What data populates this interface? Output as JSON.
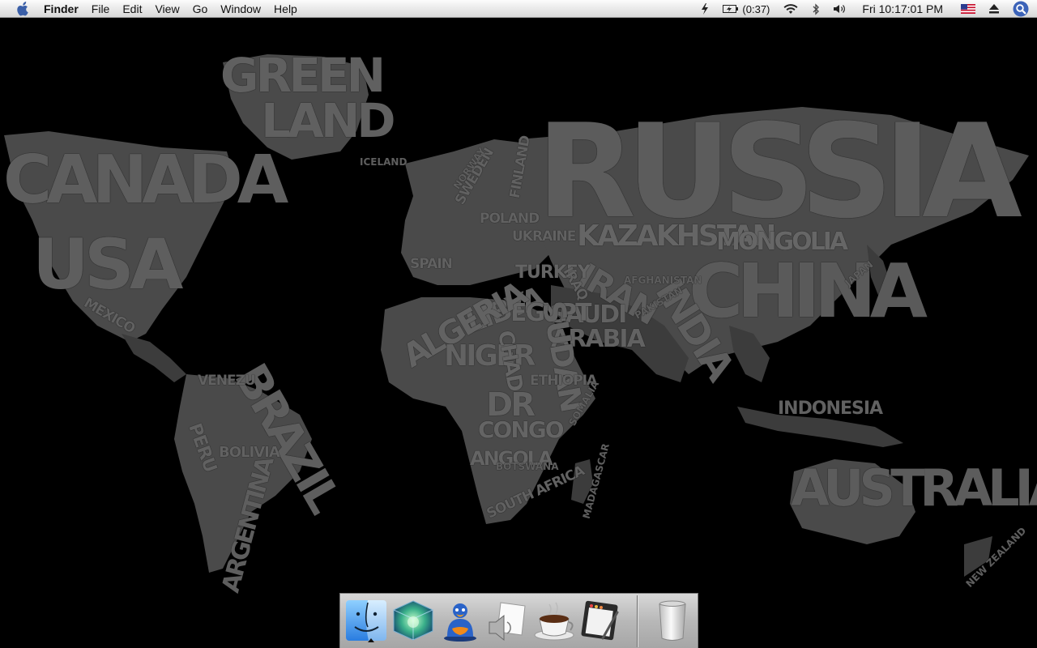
{
  "menubar": {
    "app_name": "Finder",
    "menus": [
      "File",
      "Edit",
      "View",
      "Go",
      "Window",
      "Help"
    ],
    "battery_time": "(0:37)",
    "clock": "Fri 10:17:01 PM"
  },
  "wallpaper": {
    "labels": {
      "greenland_1": "GREEN",
      "greenland_2": "LAND",
      "canada": "CANADA",
      "usa": "USA",
      "mexico": "MEXICO",
      "russia": "RUSSIA",
      "kazakhstan": "KAZAKHSTAN",
      "mongolia": "MONGOLIA",
      "china": "CHINA",
      "india": "INDIA",
      "iran": "IRAN",
      "turkey": "TURKEY",
      "saudi": "SAUDI",
      "arabia": "ARABIA",
      "libya": "LIBYA",
      "egypt": "EGYPT",
      "algeria": "ALGERIA",
      "niger": "NIGER",
      "sudan": "SUDAN",
      "chad": "CHAD",
      "drc": "DR",
      "congo": "CONGO",
      "angola": "ANGOLA",
      "south_africa": "SOUTH AFRICA",
      "brazil": "BRAZIL",
      "peru": "PERU",
      "argentina": "ARGENTINA",
      "venezuela": "VENEZU",
      "australia": "AUSTRALIA",
      "iceland": "ICELAND",
      "sweden": "SWEDEN",
      "finland": "FINLAND",
      "norway": "NORWAY",
      "ukraine": "UKRAINE",
      "poland": "POLAND",
      "spain": "SPAIN",
      "iraq": "IRAQ",
      "ethiopia": "ETHIOPIA",
      "somalia": "SOMALIA",
      "madagascar": "MADAGASCAR",
      "bolivia": "BOLIVIA",
      "new_zealand": "NEW ZEALAND",
      "japan": "JAPAN",
      "indonesia": "INDONESIA",
      "afghanistan": "AFGHANISTAN",
      "pakistan": "PAKISTAN",
      "botswana": "BOTSWANA"
    }
  },
  "dock": {
    "items": [
      {
        "name": "Finder",
        "icon": "finder-icon",
        "running": true
      },
      {
        "name": "Dashboard",
        "icon": "cube-icon",
        "running": false
      },
      {
        "name": "iChat",
        "icon": "duck-icon",
        "running": false
      },
      {
        "name": "Preview",
        "icon": "speaker-paper-icon",
        "running": false
      },
      {
        "name": "Java",
        "icon": "coffee-cup-icon",
        "running": false
      },
      {
        "name": "Sketch",
        "icon": "drawing-tablet-icon",
        "running": false
      },
      {
        "name": "Trash",
        "icon": "trash-icon",
        "running": false
      }
    ]
  },
  "colors": {
    "desktop_bg": "#000000",
    "land": "#4a4a4a",
    "menubar": "#e6e6e6"
  }
}
